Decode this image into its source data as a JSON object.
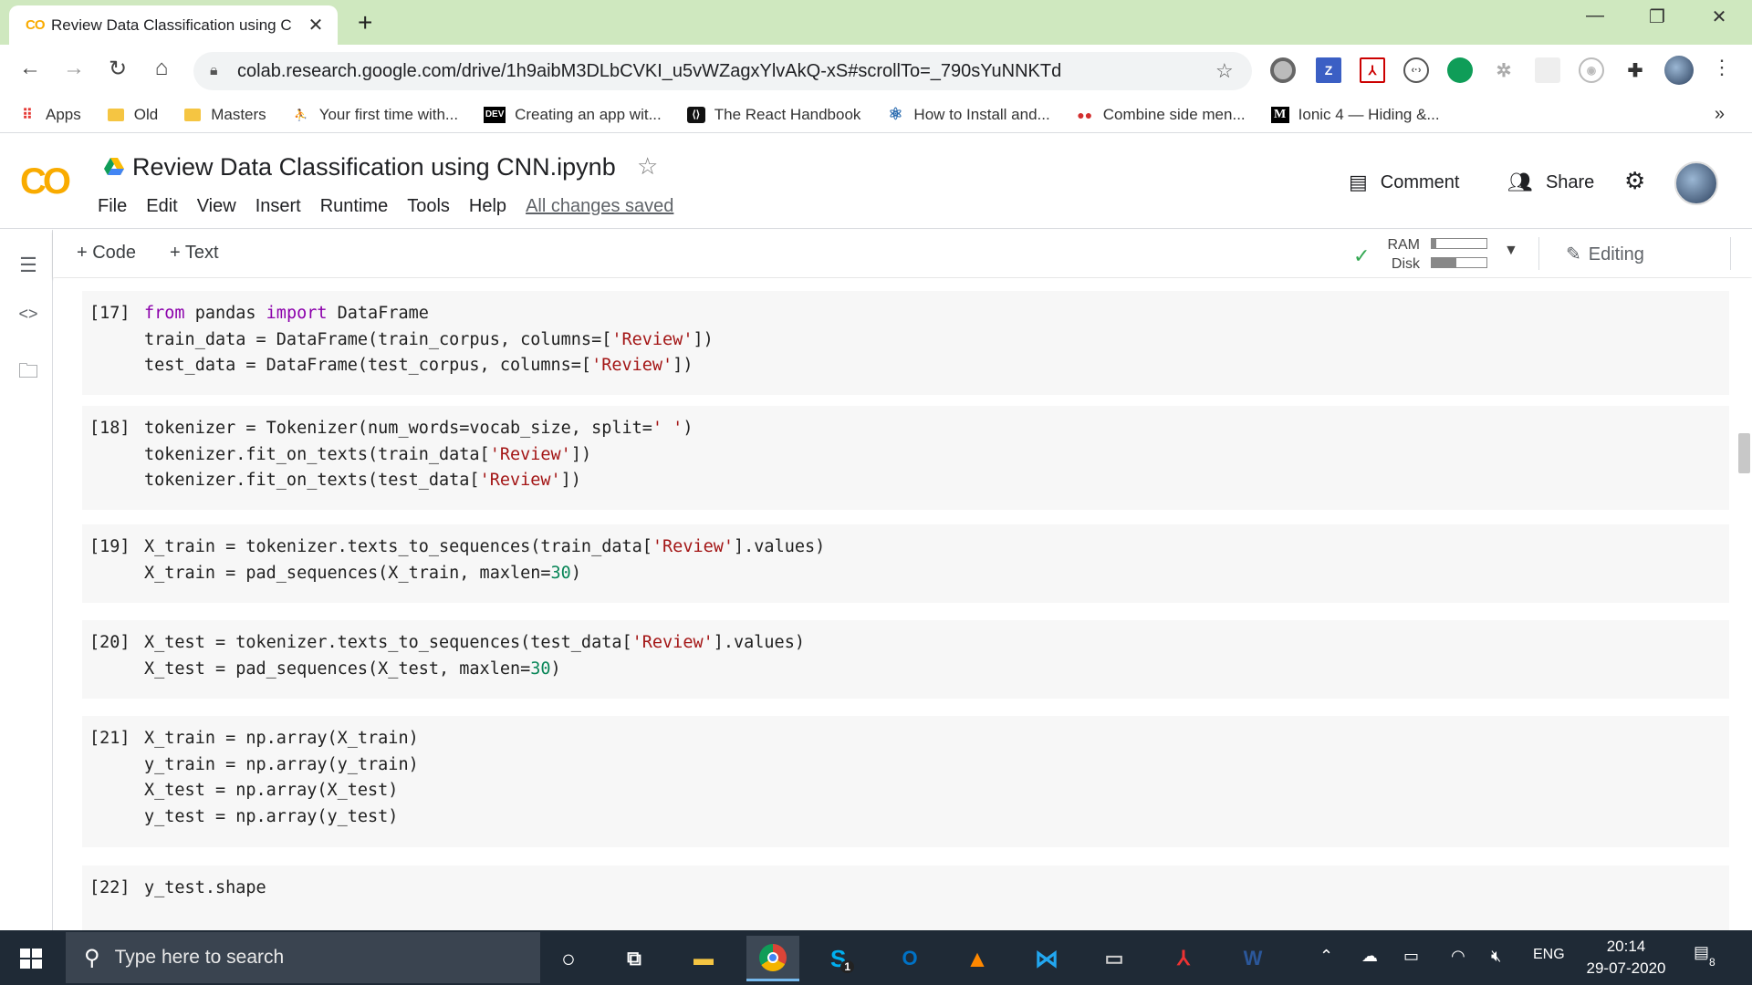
{
  "browser": {
    "tab_favicon": "CO",
    "tab_title": "Review Data Classification using C",
    "url": "colab.research.google.com/drive/1h9aibM3DLbCVKI_u5vWZagxYlvAkQ-xS#scrollTo=_790sYuNNKTd",
    "extensions": [
      "circle-ext-icon",
      "Z",
      "pdf-ext-icon",
      "code-ext-icon",
      "green-dot-ext-icon",
      "gear-ext-icon",
      "blank-ext-icon",
      "camera-ext-icon",
      "puzzle-icon",
      "profile-avatar"
    ],
    "ext_z_label": "Z"
  },
  "bookmarks": [
    {
      "label": "Apps",
      "icon": "apps-grid-icon"
    },
    {
      "label": "Old",
      "icon": "folder-icon"
    },
    {
      "label": "Masters",
      "icon": "folder-icon"
    },
    {
      "label": "Your first time with...",
      "icon": "page-icon"
    },
    {
      "label": "Creating an app wit...",
      "icon": "dev-icon",
      "icon_text": "DEV"
    },
    {
      "label": "The React Handbook",
      "icon": "react-icon"
    },
    {
      "label": "How to Install and...",
      "icon": "atom-icon"
    },
    {
      "label": "Combine side men...",
      "icon": "red-dots-icon"
    },
    {
      "label": "Ionic 4 — Hiding &...",
      "icon": "medium-icon",
      "icon_text": "M"
    }
  ],
  "colab": {
    "logo": "CO",
    "title": "Review Data Classification using CNN.ipynb",
    "menu": [
      "File",
      "Edit",
      "View",
      "Insert",
      "Runtime",
      "Tools",
      "Help"
    ],
    "save_status": "All changes saved",
    "comment_label": "Comment",
    "share_label": "Share",
    "add_code_label": "+ Code",
    "add_text_label": "+ Text",
    "ram_label": "RAM",
    "disk_label": "Disk",
    "ram_fraction": 0.08,
    "disk_fraction": 0.45,
    "editing_label": "Editing"
  },
  "cells": [
    {
      "prompt": "[17]",
      "lines": [
        [
          [
            "kw",
            "from"
          ],
          [
            "p",
            " pandas "
          ],
          [
            "kw",
            "import"
          ],
          [
            "p",
            " DataFrame"
          ]
        ],
        [
          [
            "p",
            "train_data = DataFrame(train_corpus, columns=["
          ],
          [
            "str",
            "'Review'"
          ],
          [
            "p",
            "])"
          ]
        ],
        [
          [
            "p",
            "test_data = DataFrame(test_corpus, columns=["
          ],
          [
            "str",
            "'Review'"
          ],
          [
            "p",
            "])"
          ]
        ]
      ]
    },
    {
      "prompt": "[18]",
      "lines": [
        [
          [
            "p",
            "tokenizer = Tokenizer(num_words=vocab_size, split="
          ],
          [
            "str",
            "' '"
          ],
          [
            "p",
            ")"
          ]
        ],
        [
          [
            "p",
            "tokenizer.fit_on_texts(train_data["
          ],
          [
            "str",
            "'Review'"
          ],
          [
            "p",
            "])"
          ]
        ],
        [
          [
            "p",
            "tokenizer.fit_on_texts(test_data["
          ],
          [
            "str",
            "'Review'"
          ],
          [
            "p",
            "])"
          ]
        ]
      ]
    },
    {
      "prompt": "[19]",
      "lines": [
        [
          [
            "p",
            "X_train = tokenizer.texts_to_sequences(train_data["
          ],
          [
            "str",
            "'Review'"
          ],
          [
            "p",
            "].values)"
          ]
        ],
        [
          [
            "p",
            "X_train = pad_sequences(X_train, maxlen="
          ],
          [
            "num",
            "30"
          ],
          [
            "p",
            ")"
          ]
        ]
      ]
    },
    {
      "prompt": "[20]",
      "lines": [
        [
          [
            "p",
            "X_test = tokenizer.texts_to_sequences(test_data["
          ],
          [
            "str",
            "'Review'"
          ],
          [
            "p",
            "].values)"
          ]
        ],
        [
          [
            "p",
            "X_test = pad_sequences(X_test, maxlen="
          ],
          [
            "num",
            "30"
          ],
          [
            "p",
            ")"
          ]
        ]
      ]
    },
    {
      "prompt": "[21]",
      "lines": [
        [
          [
            "p",
            "X_train = np.array(X_train)"
          ]
        ],
        [
          [
            "p",
            "y_train = np.array(y_train)"
          ]
        ],
        [
          [
            "p",
            "X_test = np.array(X_test)"
          ]
        ],
        [
          [
            "p",
            "y_test = np.array(y_test)"
          ]
        ]
      ]
    },
    {
      "prompt": "[22]",
      "lines": [
        [
          [
            "p",
            "y_test.shape"
          ]
        ]
      ]
    }
  ],
  "taskbar": {
    "search_placeholder": "Type here to search",
    "skype_badge": "1",
    "lang": "ENG",
    "time": "20:14",
    "date": "29-07-2020",
    "notification_count": "8"
  }
}
